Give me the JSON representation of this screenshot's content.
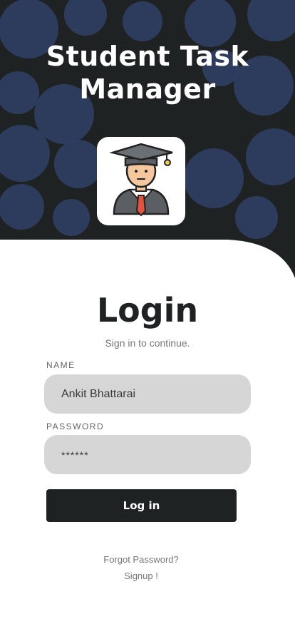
{
  "header": {
    "title_line1": "Student Task",
    "title_line2": "Manager",
    "logo_icon": "graduate-student-icon"
  },
  "form": {
    "title": "Login",
    "subtitle": "Sign in to continue.",
    "name_label": "NAME",
    "name_value": "Ankit Bhattarai",
    "password_label": "PASSWORD",
    "password_value": "******",
    "login_button": "Log in"
  },
  "links": {
    "forgot_password": "Forgot Password?",
    "signup": "Signup !"
  },
  "colors": {
    "background_dark": "#1f2223",
    "pattern_circles": "#2f3f63",
    "field_background": "#d6d6d6",
    "button": "#1f2223"
  }
}
